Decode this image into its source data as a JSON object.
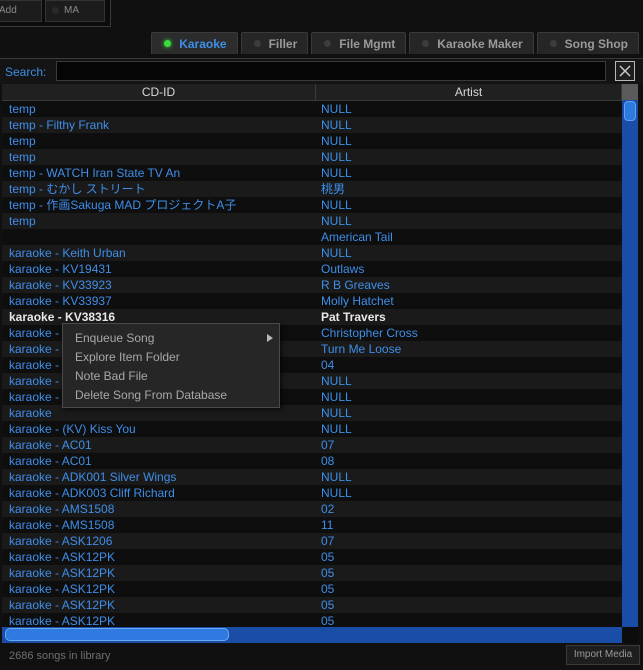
{
  "top": {
    "add_label": "Add",
    "ma_label": "MA"
  },
  "tabs": [
    {
      "label": "Karaoke",
      "active": true
    },
    {
      "label": "Filler",
      "active": false
    },
    {
      "label": "File Mgmt",
      "active": false
    },
    {
      "label": "Karaoke Maker",
      "active": false
    },
    {
      "label": "Song Shop",
      "active": false
    }
  ],
  "search": {
    "label": "Search:",
    "value": ""
  },
  "table": {
    "columns": [
      "CD-ID",
      "Artist"
    ],
    "rows": [
      [
        "temp",
        "NULL"
      ],
      [
        "temp - Filthy Frank",
        "NULL"
      ],
      [
        "temp",
        "NULL"
      ],
      [
        "temp",
        "NULL"
      ],
      [
        "temp - WATCH Iran State TV An",
        "NULL"
      ],
      [
        "temp - むかし ストリート",
        "桃男"
      ],
      [
        "temp - 作画Sakuga MAD プロジェクトA子",
        "NULL"
      ],
      [
        "temp",
        "NULL"
      ],
      [
        "",
        "American Tail"
      ],
      [
        "karaoke - Keith Urban",
        "NULL"
      ],
      [
        "karaoke - KV19431",
        "Outlaws"
      ],
      [
        "karaoke - KV33923",
        "R B Greaves"
      ],
      [
        "karaoke - KV33937",
        "Molly Hatchet"
      ],
      [
        "karaoke - KV38316",
        "Pat Travers"
      ],
      [
        "karaoke - ",
        "Christopher Cross"
      ],
      [
        "karaoke - ",
        "Turn Me Loose"
      ],
      [
        "karaoke - ",
        "04"
      ],
      [
        "karaoke - ",
        "NULL"
      ],
      [
        "karaoke - ",
        "NULL"
      ],
      [
        "karaoke",
        "NULL"
      ],
      [
        "karaoke - (KV) Kiss You",
        "NULL"
      ],
      [
        "karaoke - AC01",
        "07"
      ],
      [
        "karaoke - AC01",
        "08"
      ],
      [
        "karaoke - ADK001 Silver Wings",
        "NULL"
      ],
      [
        "karaoke - ADK003 Cliff Richard",
        "NULL"
      ],
      [
        "karaoke - AMS1508",
        "02"
      ],
      [
        "karaoke - AMS1508",
        "11"
      ],
      [
        "karaoke - ASK1206",
        "07"
      ],
      [
        "karaoke - ASK12PK",
        "05"
      ],
      [
        "karaoke - ASK12PK",
        "05"
      ],
      [
        "karaoke - ASK12PK",
        "05"
      ],
      [
        "karaoke - ASK12PK",
        "05"
      ],
      [
        "karaoke - ASK12PK",
        "05"
      ]
    ],
    "selected_row": 13
  },
  "context_menu": {
    "items": [
      "Enqueue Song",
      "Explore Item Folder",
      "Note Bad File",
      "Delete Song From Database"
    ],
    "submenu_item": 0
  },
  "status": {
    "text": "2686 songs in library",
    "import_label": "Import Media"
  },
  "colors": {
    "accent": "#3d8ee6",
    "selected_text": "#e8e8e8",
    "tab_led_active": "#3adb3a",
    "scrollbar": "#1a4ea6"
  }
}
